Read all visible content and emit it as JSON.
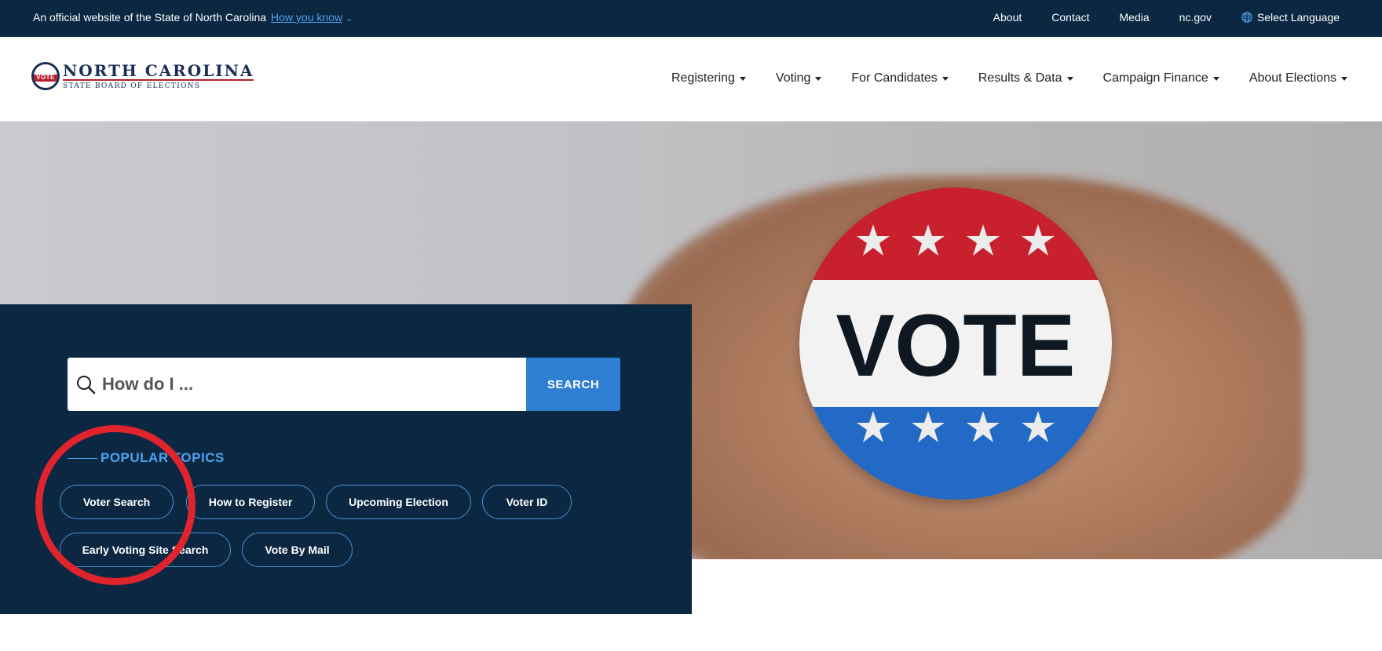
{
  "topbar": {
    "official_text": "An official website of the State of North Carolina",
    "how_you_know": "How you know",
    "links": [
      "About",
      "Contact",
      "Media",
      "nc.gov"
    ],
    "language": "Select Language",
    "background_color": "#0b2742"
  },
  "logo": {
    "title": "NORTH CAROLINA",
    "subtitle": "STATE BOARD OF ELECTIONS",
    "seal_text": "VOTE"
  },
  "nav": {
    "items": [
      "Registering",
      "Voting",
      "For Candidates",
      "Results & Data",
      "Campaign Finance",
      "About Elections"
    ]
  },
  "hero": {
    "button_text": "VOTE"
  },
  "search": {
    "placeholder": "How do I ...",
    "button_label": "SEARCH",
    "accent_color": "#2e7fd1"
  },
  "popular_topics": {
    "heading": "POPULAR TOPICS",
    "topics": [
      "Voter Search",
      "How to Register",
      "Upcoming Election",
      "Voter ID",
      "Early Voting Site Search",
      "Vote By Mail"
    ]
  },
  "annotation": {
    "circle_color": "#e0242e"
  }
}
